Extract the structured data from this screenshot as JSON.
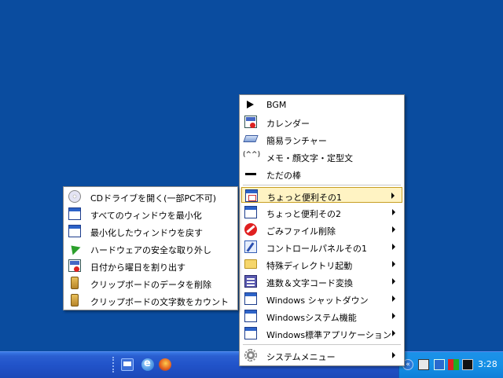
{
  "main_menu": {
    "items": [
      {
        "label": "BGM",
        "icon": "play-icon",
        "has_submenu": false
      },
      {
        "label": "カレンダー",
        "icon": "calendar-icon",
        "has_submenu": false
      },
      {
        "label": "簡易ランチャー",
        "icon": "launcher-icon",
        "has_submenu": false
      },
      {
        "label": "メモ・顔文字・定型文",
        "icon": "emoticon-icon",
        "icon_text": "(^^)",
        "has_submenu": false
      },
      {
        "label": "ただの棒",
        "icon": "bar-icon",
        "has_submenu": false
      },
      {
        "label": "ちょっと便利その1",
        "icon": "window-icon",
        "has_submenu": true,
        "highlighted": true
      },
      {
        "label": "ちょっと便利その2",
        "icon": "window-icon",
        "has_submenu": true
      },
      {
        "label": "ごみファイル削除",
        "icon": "no-entry-icon",
        "has_submenu": true
      },
      {
        "label": "コントロールパネルその1",
        "icon": "control-panel-icon",
        "has_submenu": true
      },
      {
        "label": "特殊ディレクトリ起動",
        "icon": "folder-icon",
        "has_submenu": true
      },
      {
        "label": "進数＆文字コード変換",
        "icon": "convert-icon",
        "has_submenu": true
      },
      {
        "label": "Windows シャットダウン",
        "icon": "window-icon",
        "has_submenu": true
      },
      {
        "label": "Windowsシステム機能",
        "icon": "window-icon",
        "has_submenu": true
      },
      {
        "label": "Windows標準アプリケーション",
        "icon": "window-icon",
        "has_submenu": true
      },
      {
        "label": "システムメニュー",
        "icon": "gear-icon",
        "has_submenu": true
      }
    ]
  },
  "sub_menu": {
    "items": [
      {
        "label": "CDドライブを開く(一部PC不可)",
        "icon": "cd-icon"
      },
      {
        "label": "すべてのウィンドウを最小化",
        "icon": "window-icon"
      },
      {
        "label": "最小化したウィンドウを戻す",
        "icon": "window-icon"
      },
      {
        "label": "ハードウェアの安全な取り外し",
        "icon": "green-arrow-icon"
      },
      {
        "label": "日付から曜日を割り出す",
        "icon": "calendar-icon"
      },
      {
        "label": "クリップボードのデータを削除",
        "icon": "clipboard-icon"
      },
      {
        "label": "クリップボードの文字数をカウント",
        "icon": "clipboard-icon"
      }
    ]
  },
  "taskbar": {
    "quick_launch": [
      "show-desktop-icon",
      "internet-explorer-icon",
      "firefox-icon"
    ],
    "tray_icons": [
      "tray-app-icon",
      "tray-network-icon",
      "tray-colors-icon",
      "tray-display-icon"
    ],
    "clock": "3:28"
  }
}
